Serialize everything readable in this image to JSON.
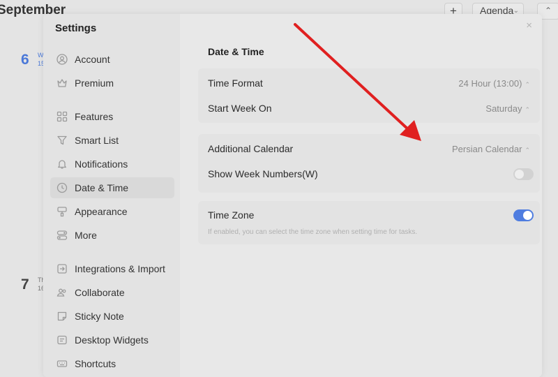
{
  "calendar": {
    "month_title": "September",
    "add_label": "+",
    "view_label": "Agenda",
    "days": [
      {
        "num": "6",
        "weekday": "W",
        "date": "15"
      },
      {
        "num": "7",
        "weekday": "Th",
        "date": "16"
      }
    ]
  },
  "settings": {
    "title": "Settings",
    "close": "×",
    "nav": [
      {
        "label": "Account",
        "icon": "account-icon"
      },
      {
        "label": "Premium",
        "icon": "crown-icon"
      },
      {
        "label": "Features",
        "icon": "features-icon"
      },
      {
        "label": "Smart List",
        "icon": "filter-icon"
      },
      {
        "label": "Notifications",
        "icon": "bell-icon"
      },
      {
        "label": "Date & Time",
        "icon": "clock-icon"
      },
      {
        "label": "Appearance",
        "icon": "brush-icon"
      },
      {
        "label": "More",
        "icon": "toggles-icon"
      },
      {
        "label": "Integrations & Import",
        "icon": "import-icon"
      },
      {
        "label": "Collaborate",
        "icon": "people-icon"
      },
      {
        "label": "Sticky Note",
        "icon": "note-icon"
      },
      {
        "label": "Desktop Widgets",
        "icon": "widget-icon"
      },
      {
        "label": "Shortcuts",
        "icon": "shortcut-icon"
      }
    ],
    "section_title": "Date & Time",
    "time_format_label": "Time Format",
    "time_format_value": "24 Hour (13:00)",
    "start_week_label": "Start Week On",
    "start_week_value": "Saturday",
    "additional_calendar_label": "Additional Calendar",
    "additional_calendar_value": "Persian Calendar",
    "show_week_numbers_label": "Show Week Numbers(W)",
    "show_week_numbers": false,
    "time_zone_label": "Time Zone",
    "time_zone_enabled": true,
    "time_zone_hint": "If enabled, you can select the time zone when setting time for tasks."
  },
  "colors": {
    "accent": "#4f7de0",
    "today": "#4a78d8",
    "annotation_arrow": "#e02020"
  }
}
